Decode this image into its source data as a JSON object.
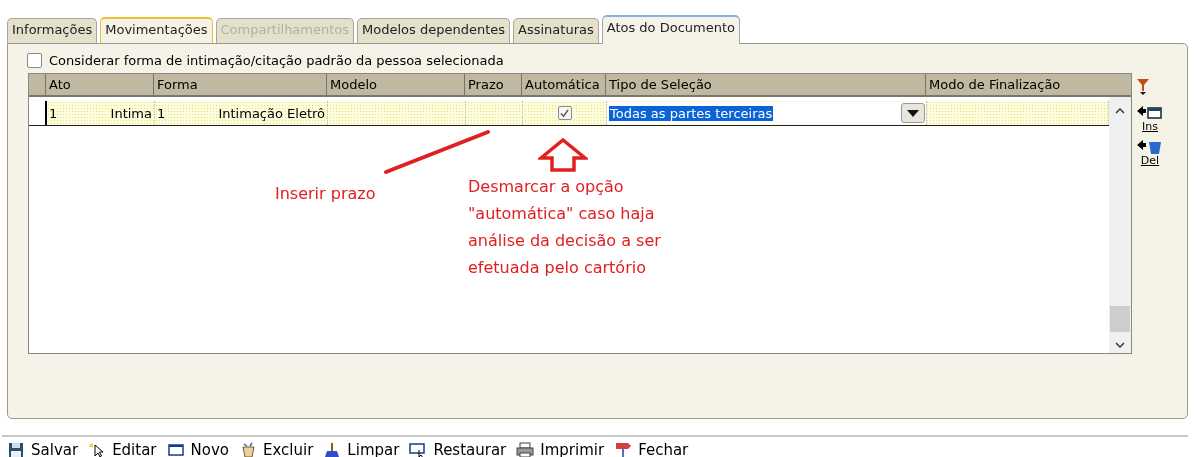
{
  "tabs": [
    {
      "label": "Informações",
      "selected": false,
      "disabled": false,
      "hot": false
    },
    {
      "label": "Movimentações",
      "selected": false,
      "disabled": false,
      "hot": true
    },
    {
      "label": "Compartilhamentos",
      "selected": false,
      "disabled": true,
      "hot": false
    },
    {
      "label": "Modelos dependentes",
      "selected": false,
      "disabled": false,
      "hot": false
    },
    {
      "label": "Assinaturas",
      "selected": false,
      "disabled": false,
      "hot": false
    },
    {
      "label": "Atos do Documento",
      "selected": true,
      "disabled": false,
      "hot": false
    }
  ],
  "default_option": {
    "label": "Considerar forma de intimação/citação padrão da pessoa selecionada",
    "checked": false
  },
  "table": {
    "columns": [
      "Ato",
      "Forma",
      "Modelo",
      "Prazo",
      "Automática",
      "Tipo de Seleção",
      "Modo de Finalização"
    ],
    "rows": [
      {
        "ato_code": "1",
        "ato": "Intima",
        "forma_code": "1",
        "forma": "Intimação Eletrô",
        "automatica": true,
        "tipo_selecao": "Todas as partes terceiras"
      }
    ]
  },
  "side_buttons": [
    "Ins",
    "Del"
  ],
  "annotations": [
    {
      "kind": "line",
      "text": "Inserir prazo"
    },
    {
      "kind": "arrow",
      "text": "Desmarcar a opção \"automática\" caso haja análise da decisão a ser efetuada pelo cartório"
    }
  ],
  "toolbar": [
    "Salvar",
    "Editar",
    "Novo",
    "Excluir",
    "Limpar",
    "Restaurar",
    "Imprimir",
    "Fechar"
  ]
}
